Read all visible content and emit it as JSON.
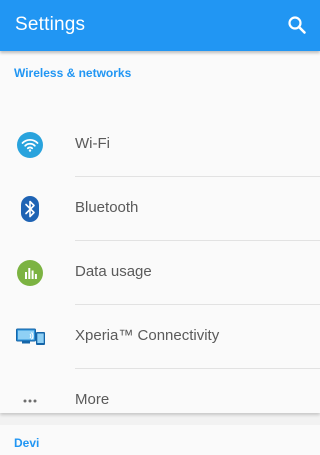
{
  "appbar": {
    "title": "Settings",
    "search_icon": "search-icon"
  },
  "sections": [
    {
      "header": "Wireless & networks",
      "items": [
        {
          "label": "Wi-Fi",
          "icon": "wifi-icon"
        },
        {
          "label": "Bluetooth",
          "icon": "bluetooth-icon"
        },
        {
          "label": "Data usage",
          "icon": "data-usage-icon"
        },
        {
          "label": "Xperia™ Connectivity",
          "icon": "xperia-connectivity-icon"
        },
        {
          "label": "More",
          "icon": "more-icon"
        }
      ]
    },
    {
      "header": "Devi"
    }
  ],
  "colors": {
    "accent": "#2196f3",
    "wifi": "#29a3dd",
    "bluetooth": "#1e63b4",
    "data_usage": "#7cb342"
  }
}
